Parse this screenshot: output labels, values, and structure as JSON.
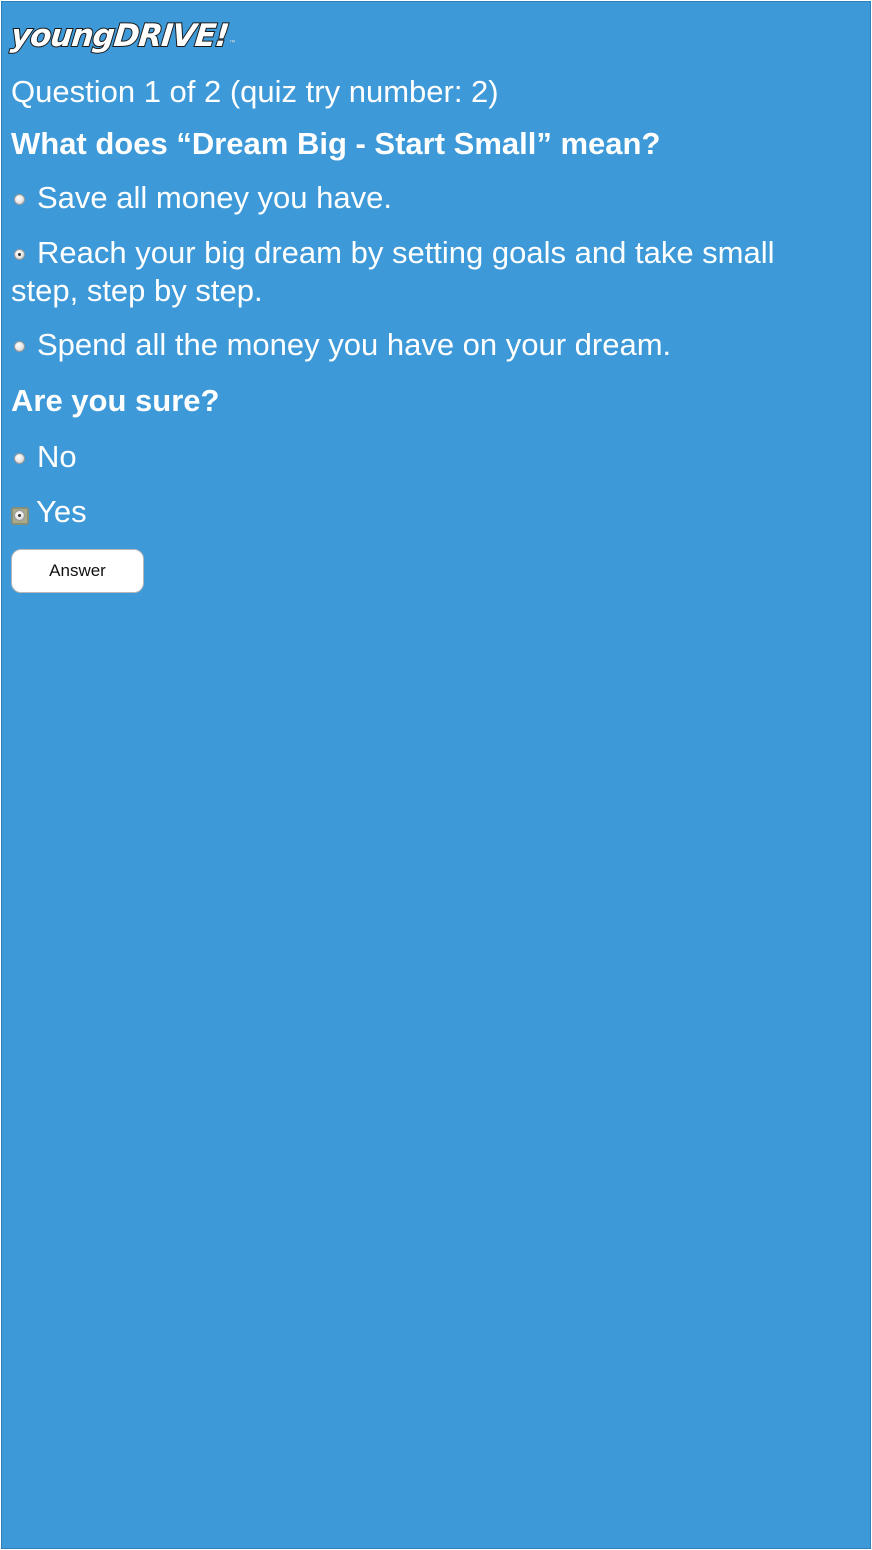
{
  "brand": {
    "logo_text": "youngDRIVE!",
    "logo_tm": "™"
  },
  "quiz": {
    "progress_text": "Question 1 of 2 (quiz try number: 2)",
    "question": "What does “Dream Big - Start Small” mean?",
    "options": [
      {
        "label": "Save all money you have.",
        "selected": false
      },
      {
        "label": "Reach your big dream by setting goals and take small step, step by step.",
        "selected": true
      },
      {
        "label": "Spend all the money you have on your dream.",
        "selected": false
      }
    ]
  },
  "confirm": {
    "title": "Are you sure?",
    "options": [
      {
        "label": "No",
        "selected": false
      },
      {
        "label": "Yes",
        "selected": true,
        "focused": true
      }
    ]
  },
  "actions": {
    "answer_label": "Answer"
  },
  "colors": {
    "background": "#3d99d8",
    "text": "#ffffff"
  }
}
